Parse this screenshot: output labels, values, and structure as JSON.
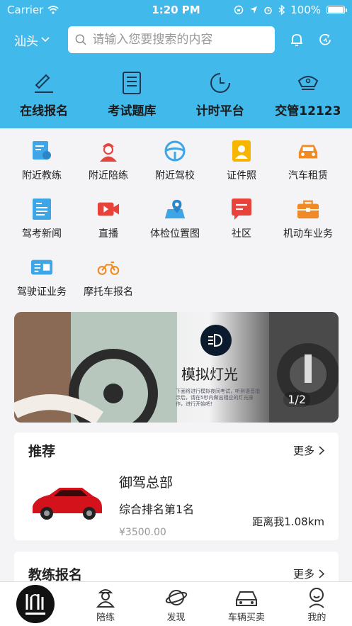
{
  "status_bar": {
    "carrier": "Carrier",
    "time": "1:20 PM",
    "battery": "100%"
  },
  "header": {
    "city": "汕头",
    "search_placeholder": "请输入您要搜索的内容"
  },
  "main_tabs": [
    {
      "label": "在线报名",
      "icon": "edit-icon"
    },
    {
      "label": "考试题库",
      "icon": "document-icon"
    },
    {
      "label": "计时平台",
      "icon": "clock-icon"
    },
    {
      "label": "交管12123",
      "icon": "police-cap-icon"
    }
  ],
  "services": [
    {
      "label": "附近教练"
    },
    {
      "label": "附近陪练"
    },
    {
      "label": "附近驾校"
    },
    {
      "label": "证件照"
    },
    {
      "label": "汽车租赁"
    },
    {
      "label": "驾考新闻"
    },
    {
      "label": "直播"
    },
    {
      "label": "体检位置图"
    },
    {
      "label": "社区"
    },
    {
      "label": "机动车业务"
    },
    {
      "label": "驾驶证业务"
    },
    {
      "label": "摩托车报名"
    }
  ],
  "banner": {
    "title": "模拟灯光",
    "subtitle": "下面将进行模拟夜间考试，听到语音指示后，请在5秒内做出相应的灯光操作，进行开始吧！",
    "page_indicator": "1/2"
  },
  "recommend": {
    "title": "推荐",
    "more": "更多",
    "school": {
      "name": "御驾总部",
      "rank": "综合排名第1名",
      "price": "¥3500.00",
      "distance": "距离我1.08km"
    }
  },
  "coach": {
    "title": "教练报名",
    "more": "更多"
  },
  "tabbar": [
    {
      "label": "",
      "logo_text": "驾联"
    },
    {
      "label": "陪练"
    },
    {
      "label": "发现"
    },
    {
      "label": "车辆买卖"
    },
    {
      "label": "我的"
    }
  ],
  "colors": {
    "header_bg": "#41b9ea",
    "icon_blue": "#3ea6e6",
    "icon_orange": "#f08a24",
    "icon_red": "#e8433a",
    "icon_yellow": "#f7b500"
  }
}
